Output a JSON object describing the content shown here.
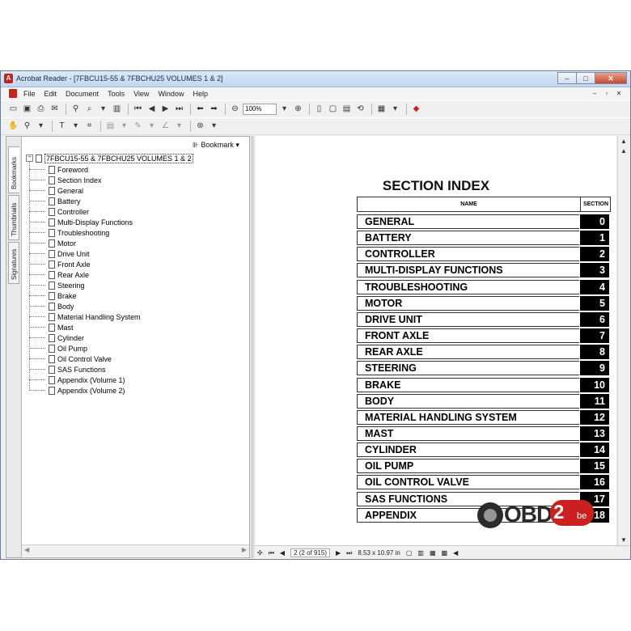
{
  "window": {
    "title": "Acrobat Reader - [7FBCU15-55 & 7FBCHU25 VOLUMES 1 & 2]",
    "app_icon_glyph": "A"
  },
  "menu": [
    "File",
    "Edit",
    "Document",
    "Tools",
    "View",
    "Window",
    "Help"
  ],
  "toolbar": {
    "zoom_value": "100%"
  },
  "nav": {
    "tabs": [
      "Bookmarks",
      "Thumbnails",
      "Signatures"
    ],
    "bookmark_menu_label": "Bookmark",
    "root": "7FBCU15-55 & 7FBCHU25 VOLUMES 1 & 2",
    "items": [
      "Foreword",
      "Section Index",
      "General",
      "Battery",
      "Controller",
      "Multi-Display Functions",
      "Troubleshooting",
      "Motor",
      "Drive Unit",
      "Front Axle",
      "Rear Axle",
      "Steering",
      "Brake",
      "Body",
      "Material Handling System",
      "Mast",
      "Cylinder",
      "Oil Pump",
      "Oil Control Valve",
      "SAS Functions",
      "Appendix (Volume 1)",
      "Appendix (Volume 2)"
    ]
  },
  "page": {
    "title": "SECTION INDEX",
    "col_name": "NAME",
    "col_section": "SECTION",
    "rows": [
      {
        "name": "GENERAL",
        "num": "0"
      },
      {
        "name": "BATTERY",
        "num": "1"
      },
      {
        "name": "CONTROLLER",
        "num": "2"
      },
      {
        "name": "MULTI-DISPLAY FUNCTIONS",
        "num": "3"
      },
      {
        "name": "TROUBLESHOOTING",
        "num": "4"
      },
      {
        "name": "MOTOR",
        "num": "5"
      },
      {
        "name": "DRIVE UNIT",
        "num": "6"
      },
      {
        "name": "FRONT AXLE",
        "num": "7"
      },
      {
        "name": "REAR AXLE",
        "num": "8"
      },
      {
        "name": "STEERING",
        "num": "9"
      },
      {
        "name": "BRAKE",
        "num": "10"
      },
      {
        "name": "BODY",
        "num": "11"
      },
      {
        "name": "MATERIAL HANDLING SYSTEM",
        "num": "12"
      },
      {
        "name": "MAST",
        "num": "13"
      },
      {
        "name": "CYLINDER",
        "num": "14"
      },
      {
        "name": "OIL PUMP",
        "num": "15"
      },
      {
        "name": "OIL CONTROL VALVE",
        "num": "16"
      },
      {
        "name": "SAS FUNCTIONS",
        "num": "17"
      },
      {
        "name": "APPENDIX",
        "num": "18"
      }
    ]
  },
  "status": {
    "page_indicator": "2 (2 of 915)",
    "page_size": "8.53 x 10.97 in"
  },
  "watermark": {
    "text": "OBD",
    "badge": "2",
    "suffix": "be"
  }
}
